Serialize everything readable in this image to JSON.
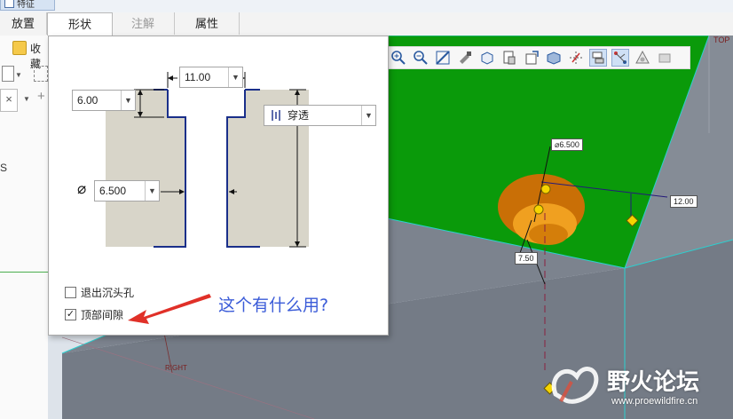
{
  "window": {
    "title_fragment": "特征"
  },
  "tabs": [
    {
      "label": "放置",
      "state": "normal"
    },
    {
      "label": "形状",
      "state": "active"
    },
    {
      "label": "注解",
      "state": "disabled"
    },
    {
      "label": "属性",
      "state": "normal"
    }
  ],
  "left_panel": {
    "item_label": "收藏",
    "side_letter": "S",
    "close_glyph": "×"
  },
  "shape_panel": {
    "depth_value": "11.00",
    "counterbore_depth_value": "6.00",
    "diameter_value": "6.500",
    "diameter_symbol": "⌀",
    "depth_option": "穿透",
    "checkbox_exit_countersink": {
      "label": "退出沉头孔",
      "checked": false
    },
    "checkbox_top_clearance": {
      "label": "顶部间隙",
      "checked": true
    }
  },
  "annotation": {
    "text": "这个有什么用?",
    "color": "#3a5bd8"
  },
  "toolbar_icons": [
    "zoom-in-icon",
    "zoom-out-icon",
    "refit-icon",
    "repaint-icon",
    "display-style-icon",
    "saved-view-icon",
    "view-manager-icon",
    "perspective-icon",
    "datum-display-icon",
    "annotation-display-icon",
    "spin-center-icon",
    "appearance-icon",
    "render-icon"
  ],
  "viewport": {
    "diameter_dim": "⌀6.500",
    "offset_dim": "12.00",
    "depth_dim": "7.50",
    "plane_top": "TOP",
    "plane_right": "RIGHT",
    "colors": {
      "top_face": "#0a9a0a",
      "side_face": "#747b86",
      "hole": "#e88c10",
      "background": "#dde3ea"
    }
  },
  "watermark": {
    "brand": "野火论坛",
    "url": "www.proewildfire.cn"
  }
}
